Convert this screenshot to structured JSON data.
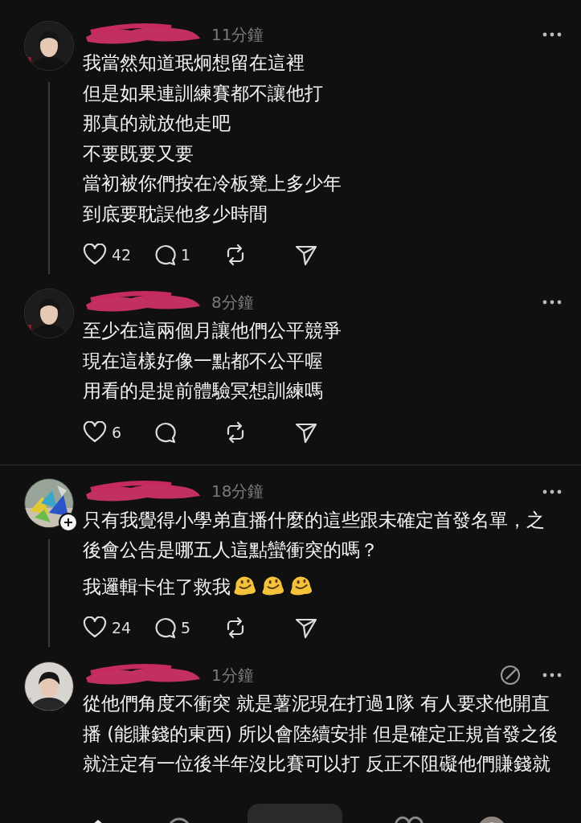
{
  "threads": [
    {
      "posts": [
        {
          "avatar": {
            "kind": "person-dark"
          },
          "time": "11分鐘",
          "thread_line": true,
          "lines": [
            "我當然知道珉炯想留在這裡",
            "但是如果連訓練賽都不讓他打",
            "那真的就放他走吧",
            "不要既要又要",
            "當初被你們按在冷板凳上多少年",
            "到底要耽誤他多少時間"
          ],
          "likes": "42",
          "replies": "1"
        },
        {
          "avatar": {
            "kind": "person-dark"
          },
          "time": "8分鐘",
          "lines": [
            "至少在這兩個月讓他們公平競爭",
            "現在這樣好像一點都不公平喔",
            "用看的是提前體驗冥想訓練嗎"
          ],
          "likes": "6"
        }
      ]
    },
    {
      "posts": [
        {
          "avatar": {
            "kind": "cranes"
          },
          "time": "18分鐘",
          "follow_badge": true,
          "thread_line": true,
          "lines": [
            "只有我覺得小學弟直播什麼的這些跟未確定首發名單，之後會公告是哪五人這點蠻衝突的嗎？",
            "我邏輯卡住了救我"
          ],
          "trailing_icons": [
            {
              "kind": "melting-face"
            },
            {
              "kind": "melting-face"
            },
            {
              "kind": "melting-face"
            }
          ],
          "likes": "24",
          "replies": "5"
        },
        {
          "avatar": {
            "kind": "person-light"
          },
          "time": "1分鐘",
          "edit_icon": true,
          "lines": [
            "從他們角度不衝突 就是薯泥現在打過1隊 有人要求他開直播 (能賺錢的東西) 所以會陸續安排 但是確定正規首發之後就注定有一位後半年沒比賽可以打 反正不阻礙他們賺錢就"
          ]
        }
      ]
    }
  ]
}
